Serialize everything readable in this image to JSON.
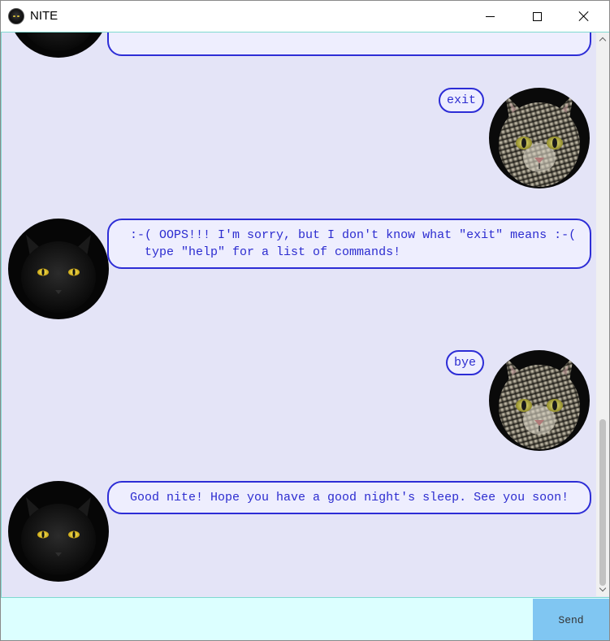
{
  "window": {
    "title": "NITE",
    "app_icon": "black-cat-icon",
    "controls": {
      "minimize": "minimize-icon",
      "maximize": "maximize-icon",
      "close": "close-icon"
    }
  },
  "chat": {
    "messages": [
      {
        "sender": "user",
        "avatar": "tabby-cat-avatar",
        "text": "exit"
      },
      {
        "sender": "bot",
        "avatar": "black-cat-avatar",
        "text": "  :-( OOPS!!! I'm sorry, but I don't know what \"exit\" means :-(\n    type \"help\" for a list of commands!"
      },
      {
        "sender": "user",
        "avatar": "tabby-cat-avatar",
        "text": "bye"
      },
      {
        "sender": "bot",
        "avatar": "black-cat-avatar",
        "text": "  Good nite! Hope you have a good night's sleep. See you soon!"
      }
    ]
  },
  "input": {
    "value": "",
    "placeholder": "",
    "send_label": "Send"
  },
  "colors": {
    "chat_background": "#e4e4f7",
    "bubble_border": "#2d2dd6",
    "bubble_fill": "#eeeefe",
    "text": "#2c2cd0",
    "input_background": "#dcffff",
    "send_button": "#80c6f2"
  }
}
